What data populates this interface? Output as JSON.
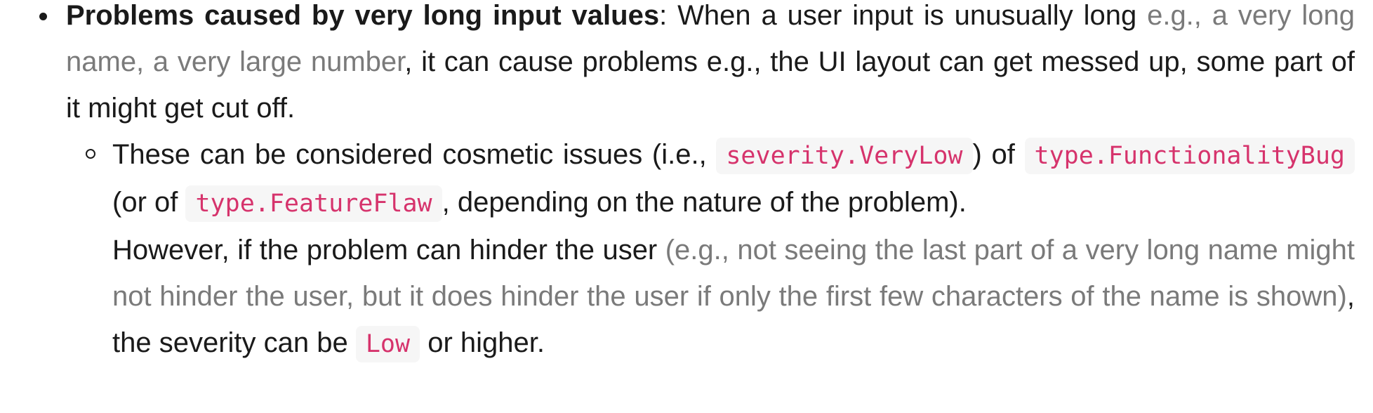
{
  "bullet": {
    "title": "Problems caused by very long input values",
    "colon": ":",
    "text_1": " When a user input is unusually long ",
    "muted_1": "e.g., a very long name, a very large number",
    "text_2": ", it can cause problems e.g., the UI layout can get messed up, some part of it might get cut off."
  },
  "sub_bullet": {
    "text_1": "These can be considered cosmetic issues (i.e., ",
    "code_1": "severity.VeryLow",
    "text_2": ") of ",
    "code_2": "type.FunctionalityBug",
    "text_3": " (or of ",
    "code_3": "type.FeatureFlaw",
    "text_4": ", depending on the nature of the problem)."
  },
  "however": {
    "text_1": "However, if the problem can hinder the user ",
    "muted_1": "(e.g., not seeing the last part of a very long name might not hinder the user, but it does hinder the user if only the first few characters of the name is shown)",
    "text_2": ", the severity can be ",
    "code_1": "Low",
    "text_3": " or higher."
  }
}
